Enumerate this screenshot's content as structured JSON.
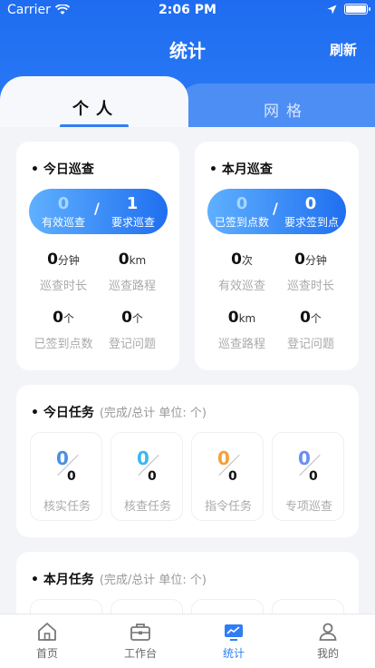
{
  "status": {
    "carrier": "Carrier",
    "time": "2:06 PM"
  },
  "nav": {
    "title": "统计",
    "refresh": "刷新"
  },
  "tabs": {
    "personal": "个人",
    "grid": "网格"
  },
  "today_patrol": {
    "title": "今日巡查",
    "pill": {
      "a_value": "0",
      "a_label": "有效巡查",
      "b_value": "1",
      "b_label": "要求巡查"
    },
    "stats": [
      {
        "value": "0",
        "unit": "分钟",
        "label": "巡查时长"
      },
      {
        "value": "0",
        "unit": "km",
        "label": "巡查路程"
      },
      {
        "value": "0",
        "unit": "个",
        "label": "已签到点数"
      },
      {
        "value": "0",
        "unit": "个",
        "label": "登记问题"
      }
    ]
  },
  "month_patrol": {
    "title": "本月巡查",
    "pill": {
      "a_value": "0",
      "a_label": "已签到点数",
      "b_value": "0",
      "b_label": "要求签到点"
    },
    "stats": [
      {
        "value": "0",
        "unit": "次",
        "label": "有效巡查"
      },
      {
        "value": "0",
        "unit": "分钟",
        "label": "巡查时长"
      },
      {
        "value": "0",
        "unit": "km",
        "label": "巡查路程"
      },
      {
        "value": "0",
        "unit": "个",
        "label": "登记问题"
      }
    ]
  },
  "today_tasks": {
    "title": "今日任务",
    "subtitle": "(完成/总计 单位: 个)",
    "items": [
      {
        "done": "0",
        "total": "0",
        "label": "核实任务",
        "color": "#4a90e2"
      },
      {
        "done": "0",
        "total": "0",
        "label": "核查任务",
        "color": "#3fb6f0"
      },
      {
        "done": "0",
        "total": "0",
        "label": "指令任务",
        "color": "#f5a03a"
      },
      {
        "done": "0",
        "total": "0",
        "label": "专项巡查",
        "color": "#6a8ef2"
      }
    ]
  },
  "month_tasks": {
    "title": "本月任务",
    "subtitle": "(完成/总计 单位: 个)"
  },
  "tabbar": [
    {
      "label": "首页",
      "icon": "home-icon"
    },
    {
      "label": "工作台",
      "icon": "briefcase-icon"
    },
    {
      "label": "统计",
      "icon": "chart-icon",
      "active": true
    },
    {
      "label": "我的",
      "icon": "user-icon"
    }
  ],
  "colors": {
    "brand": "#2b7cf6",
    "active": "#2f7ef5"
  }
}
